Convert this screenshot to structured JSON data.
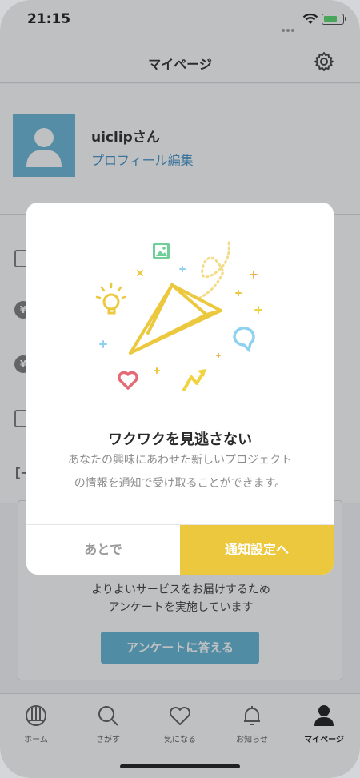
{
  "status_bar": {
    "time": "21:15"
  },
  "header": {
    "title": "マイページ",
    "settings_icon": "gear-icon"
  },
  "profile": {
    "username": "uiclipさん",
    "edit_link": "プロフィール編集",
    "avatar_color": "#62b3d6"
  },
  "menu_icons": [
    "bookmark-icon",
    "yen-coin-icon",
    "yen-coin-icon",
    "edit-icon",
    "logout-icon"
  ],
  "survey": {
    "lines": [
      "よりよいサービスをお届けするため",
      "アンケートを実施しています"
    ],
    "button_label": "アンケートに答える",
    "button_color": "#5ab4d4"
  },
  "tabs": [
    {
      "label": "ホーム",
      "icon": "home-icon"
    },
    {
      "label": "さがす",
      "icon": "search-icon"
    },
    {
      "label": "気になる",
      "icon": "heart-icon"
    },
    {
      "label": "お知らせ",
      "icon": "bell-icon"
    },
    {
      "label": "マイページ",
      "icon": "user-icon"
    }
  ],
  "modal": {
    "title": "ワクワクを見逃さない",
    "body_lines": [
      "あなたの興味にあわせた新しいプロジェクト",
      "の情報を通知で受け取ることができます。"
    ],
    "later_label": "あとで",
    "settings_label": "通知設定へ",
    "accent_color": "#ecc83f"
  }
}
